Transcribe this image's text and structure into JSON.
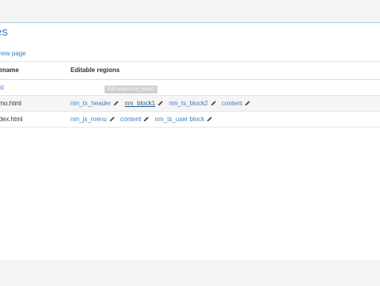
{
  "page": {
    "title": "es",
    "new_page_link": "new page"
  },
  "table": {
    "headers": [
      "ilename",
      "Editable regions"
    ],
    "rows": [
      {
        "file": "est",
        "file_is_link": true,
        "regions": []
      },
      {
        "file": "emo.html",
        "file_is_link": false,
        "regions": [
          "nm_tx_header",
          "nm_block1",
          "nm_ts_block2",
          "content"
        ]
      },
      {
        "file": "ndex.html",
        "file_is_link": false,
        "regions": [
          "nm_js_menu",
          "content",
          "nm_ts_user block"
        ]
      }
    ]
  },
  "tooltip": "Edit region nm_block1",
  "icons": {
    "edit": "pencil-icon"
  },
  "colors": {
    "link": "#3f7fbf",
    "header_border": "#a9c9e3",
    "tooltip_bg": "#cfcfcf"
  }
}
